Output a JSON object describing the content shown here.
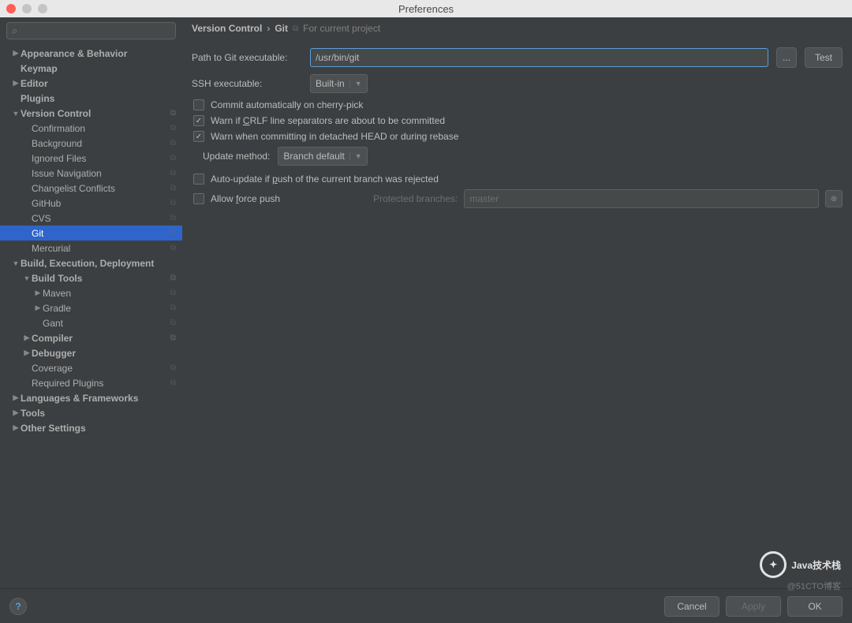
{
  "window": {
    "title": "Preferences"
  },
  "breadcrumb": {
    "main": "Version Control",
    "sub": "Git",
    "hint": "For current project"
  },
  "sidebar": {
    "search_placeholder": "",
    "items": [
      {
        "label": "Appearance & Behavior",
        "indent": 0,
        "arrow": "▶",
        "bold": true
      },
      {
        "label": "Keymap",
        "indent": 0,
        "arrow": "",
        "bold": true
      },
      {
        "label": "Editor",
        "indent": 0,
        "arrow": "▶",
        "bold": true
      },
      {
        "label": "Plugins",
        "indent": 0,
        "arrow": "",
        "bold": true
      },
      {
        "label": "Version Control",
        "indent": 0,
        "arrow": "▼",
        "bold": true,
        "proj": true
      },
      {
        "label": "Confirmation",
        "indent": 1,
        "arrow": "",
        "proj": true
      },
      {
        "label": "Background",
        "indent": 1,
        "arrow": "",
        "proj": true
      },
      {
        "label": "Ignored Files",
        "indent": 1,
        "arrow": "",
        "proj": true
      },
      {
        "label": "Issue Navigation",
        "indent": 1,
        "arrow": "",
        "proj": true
      },
      {
        "label": "Changelist Conflicts",
        "indent": 1,
        "arrow": "",
        "proj": true
      },
      {
        "label": "GitHub",
        "indent": 1,
        "arrow": "",
        "proj": true
      },
      {
        "label": "CVS",
        "indent": 1,
        "arrow": "",
        "proj": true
      },
      {
        "label": "Git",
        "indent": 1,
        "arrow": "",
        "proj": true,
        "selected": true
      },
      {
        "label": "Mercurial",
        "indent": 1,
        "arrow": "",
        "proj": true
      },
      {
        "label": "Build, Execution, Deployment",
        "indent": 0,
        "arrow": "▼",
        "bold": true
      },
      {
        "label": "Build Tools",
        "indent": 1,
        "arrow": "▼",
        "bold": true,
        "proj": true
      },
      {
        "label": "Maven",
        "indent": 2,
        "arrow": "▶",
        "proj": true
      },
      {
        "label": "Gradle",
        "indent": 2,
        "arrow": "▶",
        "proj": true
      },
      {
        "label": "Gant",
        "indent": 2,
        "arrow": "",
        "proj": true
      },
      {
        "label": "Compiler",
        "indent": 1,
        "arrow": "▶",
        "bold": true,
        "proj": true
      },
      {
        "label": "Debugger",
        "indent": 1,
        "arrow": "▶",
        "bold": true
      },
      {
        "label": "Coverage",
        "indent": 1,
        "arrow": "",
        "proj": true
      },
      {
        "label": "Required Plugins",
        "indent": 1,
        "arrow": "",
        "proj": true
      },
      {
        "label": "Languages & Frameworks",
        "indent": 0,
        "arrow": "▶",
        "bold": true
      },
      {
        "label": "Tools",
        "indent": 0,
        "arrow": "▶",
        "bold": true
      },
      {
        "label": "Other Settings",
        "indent": 0,
        "arrow": "▶",
        "bold": true
      }
    ]
  },
  "form": {
    "path_label": "Path to Git executable:",
    "path_value": "/usr/bin/git",
    "browse_label": "...",
    "test_label": "Test",
    "ssh_label": "SSH executable:",
    "ssh_value": "Built-in",
    "check_cherry": "Commit automatically on cherry-pick",
    "check_crlf_pre": "Warn if ",
    "check_crlf_u": "C",
    "check_crlf_post": "RLF line separators are about to be committed",
    "check_detached": "Warn when committing in detached HEAD or during rebase",
    "update_label": "Update method:",
    "update_value": "Branch default",
    "check_autoupdate_pre": "Auto-update if ",
    "check_autoupdate_u": "p",
    "check_autoupdate_post": "ush of the current branch was rejected",
    "check_force_pre": "Allow ",
    "check_force_u": "f",
    "check_force_post": "orce push",
    "protected_label": "Protected branches:",
    "protected_value": "master"
  },
  "footer": {
    "help": "?",
    "cancel": "Cancel",
    "apply": "Apply",
    "ok": "OK"
  },
  "watermark": {
    "text": "Java技术栈",
    "sub": "@51CTO博客"
  }
}
